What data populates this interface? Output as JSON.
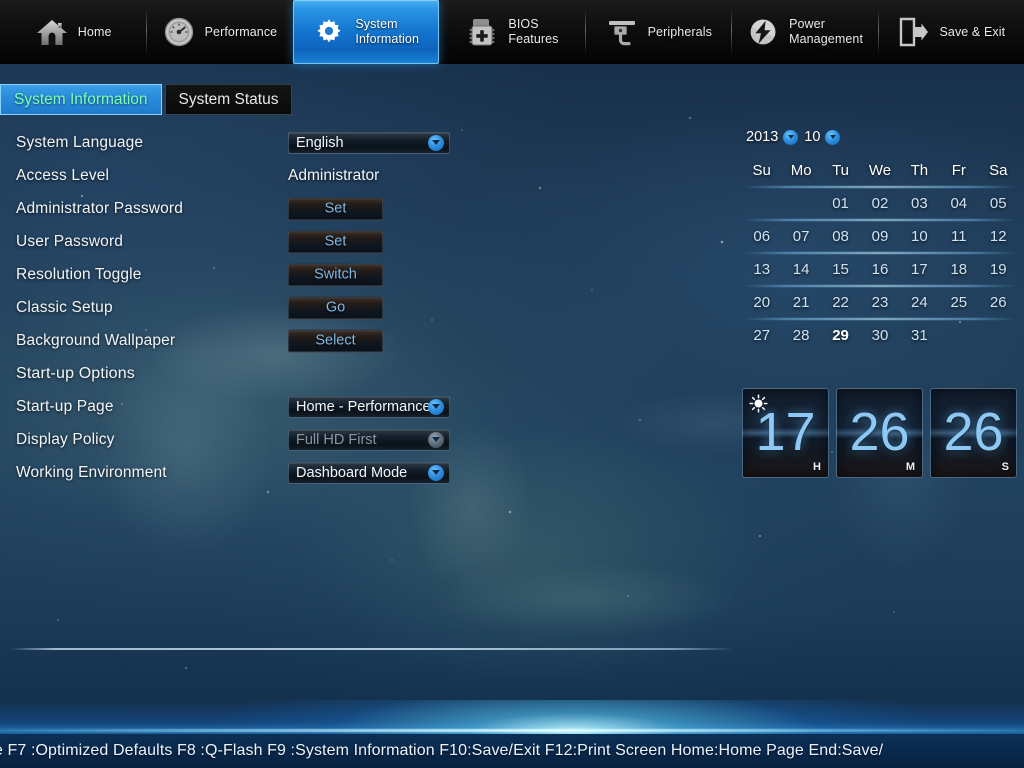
{
  "nav": {
    "items": [
      {
        "label": "Home",
        "icon": "home-icon",
        "active": false
      },
      {
        "label": "Performance",
        "icon": "gauge-icon",
        "active": false
      },
      {
        "label": "System\nInformation",
        "icon": "gear-icon",
        "active": true
      },
      {
        "label": "BIOS\nFeatures",
        "icon": "chip-plus-icon",
        "active": false
      },
      {
        "label": "Peripherals",
        "icon": "peripherals-icon",
        "active": false
      },
      {
        "label": "Power\nManagement",
        "icon": "power-bolt-icon",
        "active": false
      },
      {
        "label": "Save & Exit",
        "icon": "exit-door-icon",
        "active": false
      }
    ]
  },
  "subtabs": [
    {
      "label": "System Information",
      "active": true
    },
    {
      "label": "System Status",
      "active": false
    }
  ],
  "settings": {
    "rows": [
      {
        "label": "System Language",
        "control": "dropdown",
        "value": "English",
        "disabled": false
      },
      {
        "label": "Access Level",
        "control": "text",
        "value": "Administrator"
      },
      {
        "label": "Administrator Password",
        "control": "button",
        "value": "Set"
      },
      {
        "label": "User Password",
        "control": "button",
        "value": "Set"
      },
      {
        "label": "Resolution Toggle",
        "control": "button",
        "value": "Switch"
      },
      {
        "label": "Classic Setup",
        "control": "button",
        "value": "Go"
      },
      {
        "label": "Background Wallpaper",
        "control": "button",
        "value": "Select"
      },
      {
        "label": "Start-up Options",
        "control": "section"
      },
      {
        "label": "Start-up Page",
        "control": "dropdown",
        "value": "Home - Performance",
        "disabled": false
      },
      {
        "label": "Display Policy",
        "control": "dropdown",
        "value": "Full HD First",
        "disabled": true
      },
      {
        "label": "Working Environment",
        "control": "dropdown",
        "value": "Dashboard Mode",
        "disabled": false
      }
    ]
  },
  "calendar": {
    "year": "2013",
    "month": "10",
    "day_headers": [
      "Su",
      "Mo",
      "Tu",
      "We",
      "Th",
      "Fr",
      "Sa"
    ],
    "today": "29",
    "weeks": [
      [
        "",
        "",
        "01",
        "02",
        "03",
        "04",
        "05"
      ],
      [
        "06",
        "07",
        "08",
        "09",
        "10",
        "11",
        "12"
      ],
      [
        "13",
        "14",
        "15",
        "16",
        "17",
        "18",
        "19"
      ],
      [
        "20",
        "21",
        "22",
        "23",
        "24",
        "25",
        "26"
      ],
      [
        "27",
        "28",
        "29",
        "30",
        "31",
        "",
        ""
      ]
    ]
  },
  "clock": {
    "tiles": [
      {
        "value": "17",
        "unit": "H",
        "icon": "sun-icon"
      },
      {
        "value": "26",
        "unit": "M",
        "icon": ""
      },
      {
        "value": "26",
        "unit": "S",
        "icon": ""
      }
    ]
  },
  "statusbar": {
    "text": "e F7 :Optimized Defaults F8 :Q-Flash F9 :System Information F10:Save/Exit F12:Print Screen Home:Home Page End:Save/"
  },
  "colors": {
    "accent_blue": "#2a95e4",
    "active_tab_text": "#7dffb4",
    "clock_number": "#8ec8f5",
    "button_text": "#7fb6e2",
    "disabled_text": "#8b96a0"
  }
}
